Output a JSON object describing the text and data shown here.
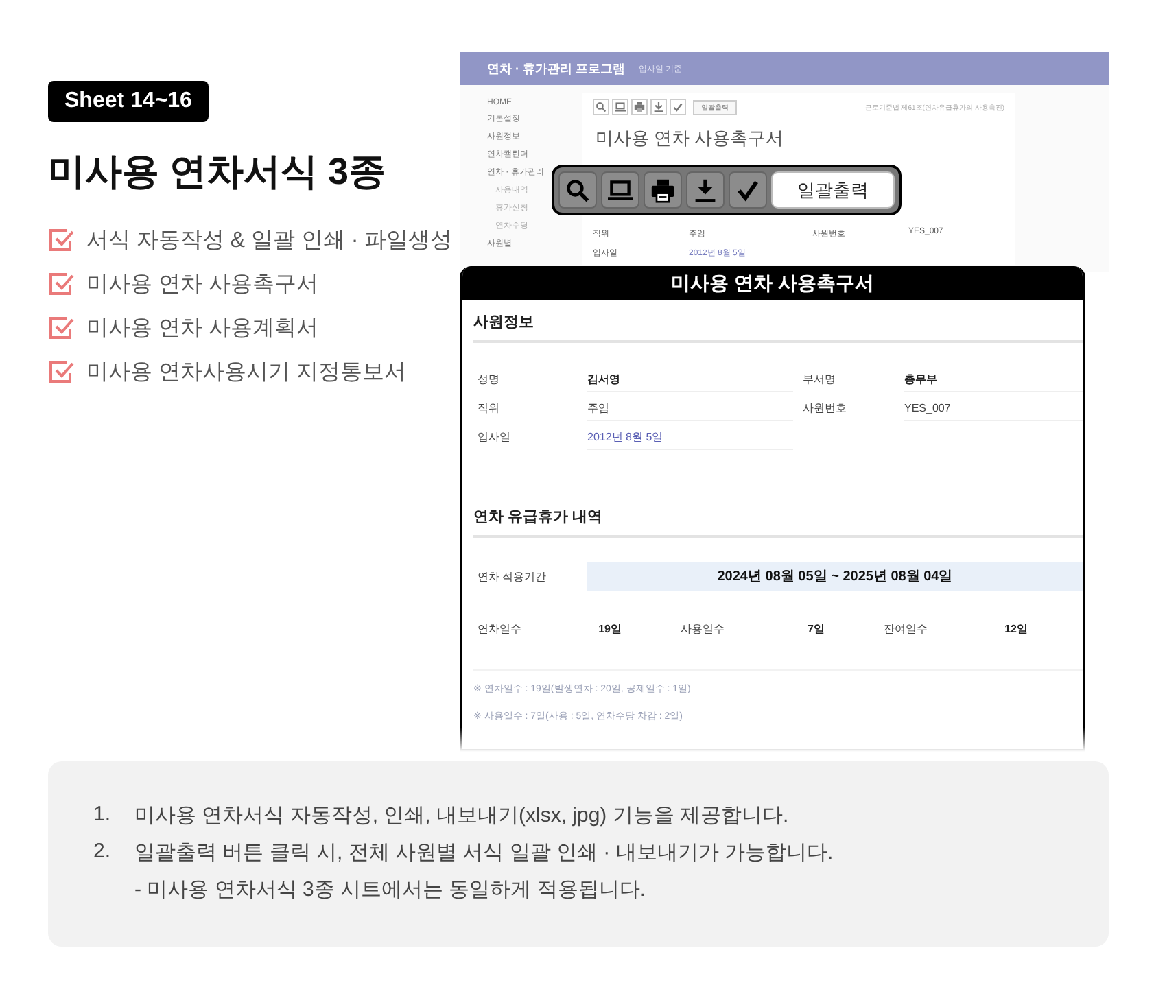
{
  "badge": "Sheet 14~16",
  "title": "미사용 연차서식 3종",
  "features": [
    "서식 자동작성 & 일괄 인쇄 · 파일생성",
    "미사용 연차 사용촉구서",
    "미사용 연차 사용계획서",
    "미사용 연차사용시기 지정통보서"
  ],
  "program": {
    "title": "연차 · 휴가관리 프로그램",
    "subtitle": "입사일 기준",
    "menu": [
      {
        "label": "HOME"
      },
      {
        "label": "기본설정"
      },
      {
        "label": "사원정보"
      },
      {
        "label": "연차캘린더"
      },
      {
        "label": "연차 · 휴가관리",
        "children": [
          {
            "label": "사용내역"
          },
          {
            "label": "휴가신청"
          },
          {
            "label": "연차수당"
          }
        ]
      },
      {
        "label": "사원별"
      }
    ],
    "print_button": "일괄출력",
    "law_note": "근로기준법 제61조(연차유급휴가의 사용촉진)",
    "doc_title": "미사용 연차 사용촉구서",
    "rows": [
      {
        "label": "직위",
        "value": "주임",
        "label_2": "사원번호",
        "value_2": "YES_007"
      },
      {
        "label": "입사일",
        "value": "2012년 8월 5일"
      }
    ]
  },
  "callout": {
    "button": "일괄출력"
  },
  "form": {
    "title": "미사용 연차 사용촉구서",
    "employee": {
      "heading": "사원정보",
      "rows": [
        {
          "label": "성명",
          "value": "김서영",
          "bold": true,
          "label_2": "부서명",
          "value_2": "총무부"
        },
        {
          "label": "직위",
          "value": "주임",
          "bold": false,
          "label_2": "사원번호",
          "value_2": "YES_007"
        },
        {
          "label": "입사일",
          "value": "2012년 8월 5일",
          "bold": false,
          "link": true
        }
      ]
    },
    "leave": {
      "heading": "연차 유급휴가 내역",
      "period_label": "연차 적용기간",
      "period": "2024년 08월 05일 ~ 2025년 08월 04일",
      "days": [
        {
          "label": "연차일수",
          "value": "19일"
        },
        {
          "label": "사용일수",
          "value": "7일"
        },
        {
          "label": "잔여일수",
          "value": "12일"
        }
      ],
      "notes": [
        "※ 연차일수 : 19일(발생연차 : 20일, 공제일수 : 1일)",
        "※ 사용일수 : 7일(사용 : 5일, 연차수당 차감 : 2일)"
      ]
    }
  },
  "notes": [
    {
      "number": "1.",
      "text": "미사용 연차서식 자동작성, 인쇄, 내보내기(xlsx, jpg) 기능을 제공합니다."
    },
    {
      "number": "2.",
      "text": "일괄출력 버튼 클릭 시, 전체 사원별 서식 일괄 인쇄 · 내보내기가 가능합니다.",
      "sub": "- 미사용 연차서식 3종 시트에서는 동일하게 적용됩니다."
    }
  ]
}
